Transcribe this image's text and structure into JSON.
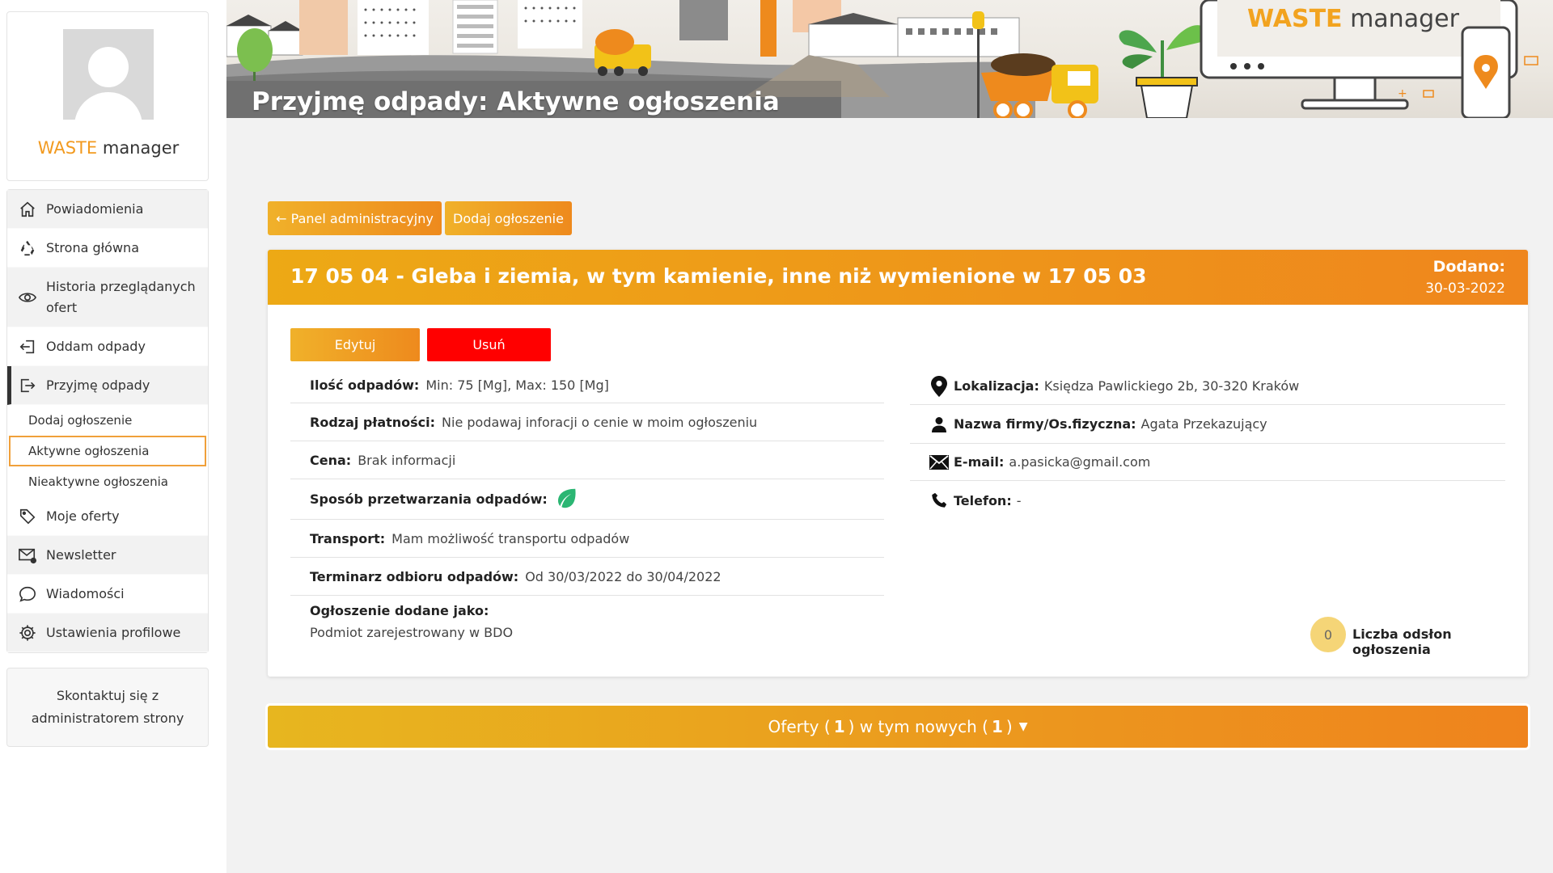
{
  "sidebar": {
    "brand": {
      "waste": "WASTE",
      "manager": "manager"
    },
    "menu": [
      {
        "label": "Powiadomienia",
        "icon": "home-icon"
      },
      {
        "label": "Strona główna",
        "icon": "recycle-icon"
      },
      {
        "label": "Historia przeglądanych ofert",
        "icon": "eye-icon"
      },
      {
        "label": "Oddam odpady",
        "icon": "sign-in-icon"
      },
      {
        "label": "Przyjmę odpady",
        "icon": "sign-out-icon"
      }
    ],
    "submenu": [
      {
        "label": "Dodaj ogłoszenie"
      },
      {
        "label": "Aktywne ogłoszenia"
      },
      {
        "label": "Nieaktywne ogłoszenia"
      }
    ],
    "menu_bottom": [
      {
        "label": "Moje oferty",
        "icon": "tags-icon"
      },
      {
        "label": "Newsletter",
        "icon": "mail-icon"
      },
      {
        "label": "Wiadomości",
        "icon": "chat-icon"
      },
      {
        "label": "Ustawienia profilowe",
        "icon": "gear-icon"
      }
    ],
    "contact": "Skontaktuj się z administratorem strony"
  },
  "banner": {
    "title": "Przyjmę odpady: Aktywne ogłoszenia",
    "brand_waste": "WASTE",
    "brand_manager": "manager"
  },
  "actions": {
    "back_label": "← Panel administracyjny",
    "add_label": "Dodaj ogłoszenie"
  },
  "listing": {
    "title": "17 05 04 - Gleba i ziemia, w tym kamienie, inne niż wymienione w 17 05 03",
    "added_label": "Dodano:",
    "added_date": "30-03-2022",
    "edit_label": "Edytuj",
    "delete_label": "Usuń",
    "quantity_label": "Ilość odpadów:",
    "quantity_value": "Min: 75 [Mg], Max: 150 [Mg]",
    "payment_label": "Rodzaj płatności:",
    "payment_value": "Nie podawaj inforacji o cenie w moim ogłoszeniu",
    "price_label": "Cena:",
    "price_value": "Brak informacji",
    "processing_label": "Sposób przetwarzania odpadów:",
    "processing_icon": "leaf-icon",
    "transport_label": "Transport:",
    "transport_value": "Mam możliwość transportu odpadów",
    "schedule_label": "Terminarz odbioru odpadów:",
    "schedule_value": "Od 30/03/2022 do 30/04/2022",
    "added_as_label": "Ogłoszenie dodane jako:",
    "added_as_value": "Podmiot zarejestrowany w BDO",
    "location_label": "Lokalizacja:",
    "location_value": "Księdza Pawlickiego 2b, 30-320 Kraków",
    "company_label": "Nazwa firmy/Os.fizyczna:",
    "company_value": "Agata Przekazujący",
    "email_label": "E-mail:",
    "email_value": "a.pasicka@gmail.com",
    "phone_label": "Telefon:",
    "phone_value": "-",
    "views_count": "0",
    "views_label": "Liczba odsłon ogłoszenia"
  },
  "offers": {
    "prefix": "Oferty (",
    "count": "1",
    "middle": ") w tym nowych (",
    "new_count": "1",
    "suffix": ")"
  },
  "colors": {
    "accent": "#ee8a1d",
    "accent_light": "#f0b12a",
    "delete": "#ff0000",
    "leaf": "#2bb673"
  }
}
